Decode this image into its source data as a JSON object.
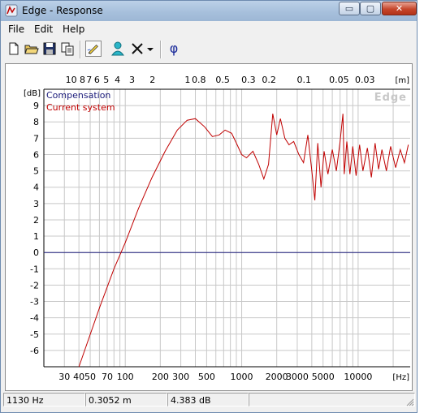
{
  "window": {
    "title": "Edge - Response",
    "controls": {
      "minimize": "▭",
      "maximize": "▢",
      "close": "✕"
    }
  },
  "menu": {
    "items": [
      "File",
      "Edit",
      "Help"
    ]
  },
  "toolbar": {
    "buttons": [
      {
        "icon": "new-document-icon"
      },
      {
        "icon": "open-folder-icon"
      },
      {
        "icon": "save-disk-icon"
      },
      {
        "icon": "copy-icon"
      },
      {
        "icon": "draw-pencil-icon",
        "pressed": true
      },
      {
        "icon": "person-speaker-icon"
      },
      {
        "icon": "cross-marker-icon"
      },
      {
        "icon": "dropdown-arrow-icon"
      },
      {
        "icon": "phi-icon",
        "text": "φ"
      }
    ]
  },
  "chart_data": {
    "type": "line",
    "watermark": "Edge",
    "legend": [
      "Compensation",
      "Current system"
    ],
    "legend_placement": "top-left",
    "colors": {
      "Compensation": "#1a1a7a",
      "Current system": "#c00000",
      "grid": "#c8c8c8"
    },
    "x_scale": "log",
    "xlim": [
      20,
      28000
    ],
    "ylim": [
      -7,
      10
    ],
    "x_unit": "[Hz]",
    "y_unit": "[dB]",
    "top_unit": "[m]",
    "grid": true,
    "x_ticks": [
      "30",
      "40",
      "50",
      "70",
      "100",
      "200",
      "300",
      "500",
      "1000",
      "2000",
      "3000",
      "5000",
      "10000"
    ],
    "y_ticks": [
      "9",
      "8",
      "7",
      "6",
      "5",
      "4",
      "3",
      "2",
      "1",
      "0",
      "-1",
      "-2",
      "-3",
      "-4",
      "-5",
      "-6"
    ],
    "top_ticks": [
      "10",
      "8",
      "7",
      "6",
      "5",
      "4",
      "3",
      "2",
      "1",
      "0.8",
      "0.5",
      "0.3",
      "0.2",
      "0.1",
      "0.05",
      "0.03"
    ],
    "series": [
      {
        "name": "Compensation",
        "x": [
          20,
          28000
        ],
        "y": [
          0,
          0
        ]
      },
      {
        "name": "Current system",
        "x": [
          40,
          60,
          80,
          100,
          130,
          170,
          220,
          280,
          340,
          400,
          480,
          560,
          640,
          720,
          820,
          900,
          1000,
          1100,
          1250,
          1400,
          1550,
          1700,
          1850,
          2000,
          2150,
          2350,
          2550,
          2800,
          3100,
          3400,
          3700,
          4000,
          4250,
          4500,
          4800,
          5100,
          5500,
          6000,
          6500,
          7000,
          7400,
          7600,
          8000,
          8500,
          9000,
          9600,
          10300,
          11000,
          12000,
          13000,
          14000,
          15000,
          16000,
          17500,
          19000,
          21000,
          23000,
          25000,
          27000
        ],
        "y": [
          -7,
          -3.4,
          -1.0,
          0.6,
          2.7,
          4.6,
          6.2,
          7.5,
          8.1,
          8.2,
          7.7,
          7.1,
          7.2,
          7.5,
          7.3,
          6.7,
          6.0,
          5.8,
          6.2,
          5.4,
          4.5,
          5.4,
          8.5,
          7.2,
          8.2,
          7.0,
          6.6,
          6.8,
          6.0,
          5.5,
          7.2,
          5.0,
          3.2,
          6.7,
          4.0,
          6.2,
          4.8,
          6.3,
          5.0,
          6.8,
          8.5,
          4.8,
          6.8,
          4.8,
          6.5,
          4.7,
          6.6,
          5.0,
          6.4,
          4.6,
          6.7,
          5.1,
          6.3,
          5.0,
          6.5,
          5.2,
          6.3,
          5.5,
          6.6
        ]
      }
    ]
  },
  "status": {
    "frequency": "1130 Hz",
    "distance": "0.3052 m",
    "level": "4.383 dB"
  }
}
